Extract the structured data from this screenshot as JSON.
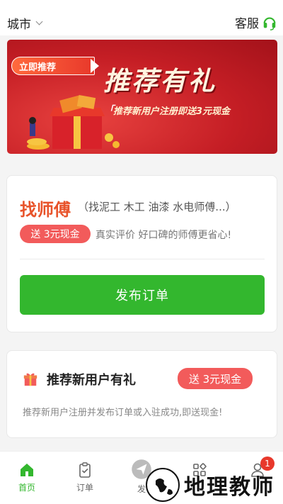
{
  "header": {
    "city_label": "城市",
    "service_label": "客服"
  },
  "banner": {
    "tag": "立即推荐",
    "title": "推荐有礼",
    "subtitle": "推荐新用户注册即送3元现金"
  },
  "find_card": {
    "title": "找师傅",
    "subtitle": "（找泥工 木工 油漆 水电师傅...）",
    "cash_badge": "送 3元现金",
    "description": "真实评价 好口碑的师傅更省心!",
    "publish_button": "发布订单"
  },
  "referral_card": {
    "title": "推荐新用户有礼",
    "cash_badge": "送 3元现金",
    "description": "推荐新用户注册并发布订单或入驻成功,即送现金!"
  },
  "tabbar": {
    "items": [
      {
        "label": "首页",
        "icon": "home-icon",
        "active": true
      },
      {
        "label": "订单",
        "icon": "order-icon",
        "active": false
      },
      {
        "label": "发",
        "icon": "publish-icon",
        "active": false
      },
      {
        "label": "",
        "icon": "apps-icon",
        "active": false
      },
      {
        "label": "",
        "icon": "user-icon",
        "active": false
      }
    ],
    "badge_count": "1"
  },
  "watermark": {
    "text": "地理教师"
  },
  "colors": {
    "accent_green": "#33b72e",
    "accent_orange": "#e8532a",
    "badge_red": "#f25b5b",
    "banner_red": "#c51e25"
  }
}
